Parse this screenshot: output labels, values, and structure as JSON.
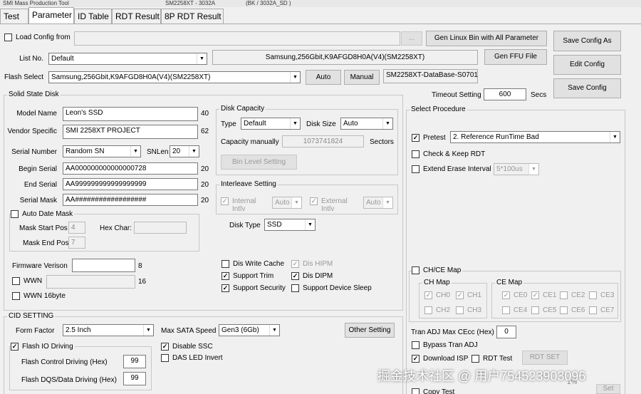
{
  "window": {
    "title_left": "SMI Mass Production Tool",
    "title_mid": "SM2258XT - 3032A",
    "title_right": "(BK / 3032A_SD )"
  },
  "tabs": [
    "Test",
    "Parameter",
    "ID Table",
    "RDT Result",
    "8P RDT Result"
  ],
  "config": {
    "load_config_label": "Load Config from",
    "load_config_checked": false,
    "browse_label": "...",
    "list_no_label": "List No.",
    "list_no_value": "Default",
    "list_no_display": "Samsung,256Gbit,K9AFGD8H0A(V4)(SM2258XT)",
    "flash_select_label": "Flash Select",
    "flash_select_value": "Samsung,256Gbit,K9AFGD8H0A(V4)(SM2258XT)",
    "auto_label": "Auto",
    "manual_label": "Manual",
    "database_display": "SM2258XT-DataBase-S0701",
    "gen_linux_label": "Gen Linux Bin with All Parameter",
    "gen_ffu_label": "Gen FFU File",
    "save_config_as_label": "Save Config As",
    "edit_config_label": "Edit Config",
    "save_config_label": "Save Config",
    "timeout_label": "Timeout Setting",
    "timeout_value": "600",
    "timeout_unit": "Secs"
  },
  "ssd": {
    "group_label": "Solid State Disk",
    "model_name_label": "Model Name",
    "model_name_value": "Leon's SSD",
    "model_name_len": "40",
    "vendor_label": "Vendor Specific",
    "vendor_value": "SMI 2258XT PROJECT",
    "vendor_len": "62",
    "serial_number_label": "Serial Number",
    "serial_number_value": "Random SN",
    "snlen_label": "SNLen",
    "snlen_value": "20",
    "begin_serial_label": "Begin Serial",
    "begin_serial_value": "AA000000000000000728",
    "begin_serial_len": "20",
    "end_serial_label": "End Serial",
    "end_serial_value": "AA999999999999999999",
    "end_serial_len": "20",
    "serial_mask_label": "Serial Mask",
    "serial_mask_value": "AA##################",
    "serial_mask_len": "20",
    "auto_date_mask_label": "Auto Date Mask",
    "auto_date_mask_checked": false,
    "mask_start_label": "Mask Start Pos",
    "mask_start_value": "4",
    "hex_char_label": "Hex Char:",
    "hex_char_value": "",
    "mask_end_label": "Mask End Pos",
    "mask_end_value": "7",
    "firmware_label": "Firmware Verison",
    "firmware_value": "",
    "firmware_len": "8",
    "wwn_label": "WWN",
    "wwn_checked": false,
    "wwn_value": "",
    "wwn_len": "16",
    "wwn16_label": "WWN 16byte",
    "wwn16_checked": false
  },
  "disk_capacity": {
    "group_label": "Disk Capacity",
    "type_label": "Type",
    "type_value": "Default",
    "disk_size_label": "Disk Size",
    "disk_size_value": "Auto",
    "capacity_manual_label": "Capacity manually",
    "capacity_value": "1073741824",
    "sectors_label": "Sectors",
    "bin_level_label": "Bin Level Setting"
  },
  "interleave": {
    "group_label": "Interleave Setting",
    "internal_label": "Internal Intlv",
    "internal_checked": true,
    "internal_value": "Auto",
    "external_label": "External Intlv",
    "external_checked": true,
    "external_value": "Auto"
  },
  "disk_type": {
    "label": "Disk Type",
    "value": "SSD"
  },
  "options": {
    "dis_write_cache": {
      "label": "Dis Write Cache",
      "checked": false
    },
    "dis_hipm": {
      "label": "Dis HIPM",
      "checked": true
    },
    "support_trim": {
      "label": "Support Trim",
      "checked": true
    },
    "dis_dipm": {
      "label": "Dis DIPM",
      "checked": true
    },
    "support_security": {
      "label": "Support Security",
      "checked": true
    },
    "support_device_sleep": {
      "label": "Support Device Sleep",
      "checked": false
    }
  },
  "cid": {
    "group_label": "CID SETTING",
    "form_factor_label": "Form Factor",
    "form_factor_value": "2.5 Inch",
    "max_sata_label": "Max SATA Speed",
    "max_sata_value": "Gen3 (6Gb)",
    "other_setting_label": "Other Setting",
    "flash_io_label": "Flash IO Driving",
    "flash_io_checked": true,
    "flash_control_label": "Flash Control Driving (Hex)",
    "flash_control_value": "99",
    "flash_dqs_label": "Flash DQS/Data Driving (Hex)",
    "flash_dqs_value": "99",
    "disable_ssc_label": "Disable SSC",
    "disable_ssc_checked": true,
    "das_led_label": "DAS LED Invert",
    "das_led_checked": false
  },
  "procedure": {
    "group_label": "Select Procedure",
    "pretest_label": "Pretest",
    "pretest_checked": true,
    "pretest_value": "2. Reference RunTime Bad",
    "check_keep_rdt_label": "Check & Keep RDT",
    "check_keep_rdt_checked": false,
    "extend_erase_label": "Extend Erase Interval",
    "extend_erase_checked": false,
    "extend_erase_value": "5*100us",
    "ch_ce_map_label": "CH/CE Map",
    "ch_ce_map_checked": false,
    "ch_map_label": "CH Map",
    "ch_items": [
      {
        "label": "CH0",
        "checked": true
      },
      {
        "label": "CH1",
        "checked": true
      },
      {
        "label": "CH2",
        "checked": false
      },
      {
        "label": "CH3",
        "checked": false
      }
    ],
    "ce_map_label": "CE Map",
    "ce_items": [
      {
        "label": "CE0",
        "checked": true
      },
      {
        "label": "CE1",
        "checked": true
      },
      {
        "label": "CE2",
        "checked": false
      },
      {
        "label": "CE3",
        "checked": false
      },
      {
        "label": "CE4",
        "checked": false
      },
      {
        "label": "CE5",
        "checked": false
      },
      {
        "label": "CE6",
        "checked": false
      },
      {
        "label": "CE7",
        "checked": false
      }
    ],
    "tran_adj_label": "Tran ADJ Max CEcc (Hex)",
    "tran_adj_value": "0",
    "bypass_tran_label": "Bypass Tran ADJ",
    "bypass_tran_checked": false,
    "download_isp_label": "Download ISP",
    "download_isp_checked": true,
    "rdt_test_label": "RDT Test",
    "rdt_test_checked": false,
    "rdt_set_label": "RDT SET",
    "copy_test_label": "Copy Test",
    "copy_test_checked": false,
    "percent_label": "1%",
    "set_label": "Set"
  },
  "watermark": "掘金技术社区 @ 用户754523903096"
}
